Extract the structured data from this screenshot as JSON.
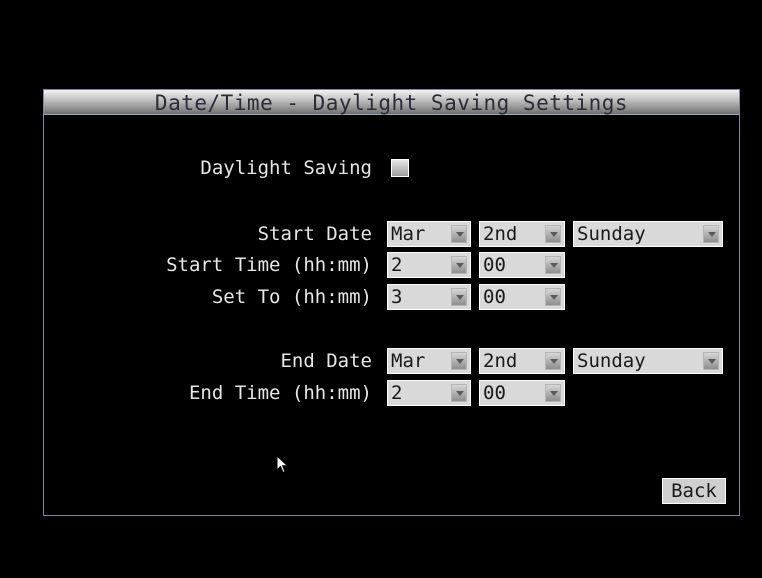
{
  "dialog": {
    "title": "Date/Time - Daylight Saving Settings"
  },
  "daylight_saving": {
    "label": "Daylight Saving",
    "checked": false
  },
  "start_date": {
    "label": "Start Date",
    "month": "Mar",
    "week": "2nd",
    "day": "Sunday"
  },
  "start_time": {
    "label": "Start Time (hh:mm)",
    "hour": "2",
    "minute": "00"
  },
  "set_to": {
    "label": "Set To (hh:mm)",
    "hour": "3",
    "minute": "00"
  },
  "end_date": {
    "label": "End Date",
    "month": "Mar",
    "week": "2nd",
    "day": "Sunday"
  },
  "end_time": {
    "label": "End Time (hh:mm)",
    "hour": "2",
    "minute": "00"
  },
  "buttons": {
    "back": "Back"
  },
  "icons": {
    "cursor": "mouse-pointer-icon",
    "dropdown": "chevron-down-icon"
  }
}
